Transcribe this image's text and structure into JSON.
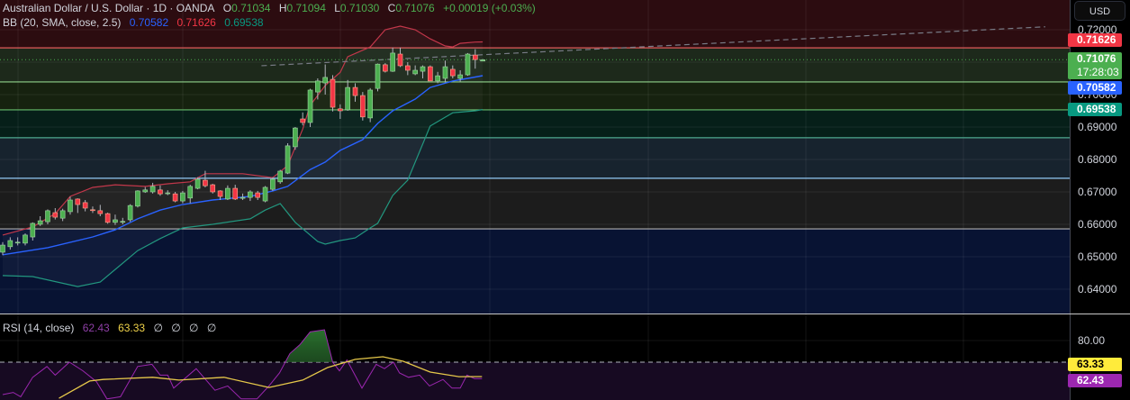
{
  "header": {
    "symbol": "Australian Dollar / U.S. Dollar · 1D · OANDA",
    "o_label": "O",
    "o": "0.71034",
    "h_label": "H",
    "h": "0.71094",
    "l_label": "L",
    "l": "0.71030",
    "c_label": "C",
    "c": "0.71076",
    "change": "+0.00019 (+0.03%)"
  },
  "bb_legend": {
    "label": "BB (20, SMA, close, 2.5)",
    "basis": "0.70582",
    "upper": "0.71626",
    "lower": "0.69538"
  },
  "rsi_legend": {
    "label": "RSI (14, close)",
    "rsi": "62.43",
    "ma": "63.33",
    "empties": [
      "∅",
      "∅",
      "∅",
      "∅"
    ]
  },
  "price_axis": {
    "currency": "USD",
    "ticks": [
      {
        "text": "0.72000",
        "value": 0.72
      },
      {
        "text": "0.70000",
        "value": 0.7
      },
      {
        "text": "0.69000",
        "value": 0.69
      },
      {
        "text": "0.68000",
        "value": 0.68
      },
      {
        "text": "0.67000",
        "value": 0.67
      },
      {
        "text": "0.66000",
        "value": 0.66
      },
      {
        "text": "0.65000",
        "value": 0.65
      },
      {
        "text": "0.64000",
        "value": 0.64
      }
    ],
    "badges": [
      {
        "name": "bb-upper-price-badge",
        "text": "0.71626",
        "value": 0.71626,
        "color": "#f23645",
        "text_color": "#ffffff"
      },
      {
        "name": "last-price-badge",
        "text": "0.71076",
        "sub": "17:28:03",
        "value": 0.71076,
        "color": "#4caf50",
        "text_color": "#ffffff"
      },
      {
        "name": "bb-basis-price-badge",
        "text": "0.70582",
        "value": 0.70582,
        "color": "#2962ff",
        "text_color": "#ffffff"
      },
      {
        "name": "bb-lower-price-badge",
        "text": "0.69538",
        "value": 0.69538,
        "color": "#089981",
        "text_color": "#ffffff"
      }
    ]
  },
  "rsi_axis": {
    "ticks": [
      {
        "text": "80.00",
        "value": 80
      }
    ],
    "badges": [
      {
        "name": "rsi-ma-badge",
        "text": "63.33",
        "value": 63.33,
        "color": "#ffeb3b",
        "text_color": "#000000"
      },
      {
        "name": "rsi-value-badge",
        "text": "62.43",
        "value": 62.43,
        "color": "#9c27b0",
        "text_color": "#ffffff"
      }
    ]
  },
  "colors": {
    "up": "#4caf50",
    "down": "#f23645",
    "wick": "#b2b5be",
    "bb_basis": "#2962ff",
    "bb_upper": "#c2374a",
    "bb_lower": "#22977f",
    "rsi_line": "#9c27b0",
    "rsi_ma": "#e6c84a",
    "trend_line": "#787b86",
    "last_price_line": "#4caf50"
  },
  "levels": [
    {
      "price": 0.7144,
      "line": "#e05a5a",
      "fill_above": "#2c0c10",
      "fill_below": "#1d291b"
    },
    {
      "price": 0.7039,
      "line": "#8fd18a",
      "fill_below": "#16220f"
    },
    {
      "price": 0.6953,
      "line": "#66bb6a",
      "fill_below": "#061f19"
    },
    {
      "price": 0.6867,
      "line": "#4fa88f",
      "fill_below": "#17232e"
    },
    {
      "price": 0.6742,
      "line": "#90caf9",
      "fill_below": "#1c1c1c"
    },
    {
      "price": 0.6586,
      "line": "#b0b0b0",
      "fill_below": "#081333"
    }
  ],
  "trend_line": {
    "style": "dashed",
    "points": [
      [
        34.5,
        0.7089
      ],
      [
        139,
        0.7209
      ]
    ]
  },
  "chart_data": [
    {
      "type": "candlestick",
      "symbol": "AUDUSD",
      "timeframe": "1D",
      "ylim": [
        0.6365,
        0.7292
      ],
      "grid": true,
      "ohlc_fields": [
        "open",
        "high",
        "low",
        "close"
      ],
      "candles": [
        [
          0.6514,
          0.6545,
          0.6505,
          0.6536
        ],
        [
          0.6531,
          0.656,
          0.6522,
          0.655
        ],
        [
          0.6544,
          0.656,
          0.6535,
          0.6545
        ],
        [
          0.6542,
          0.6572,
          0.6535,
          0.6567
        ],
        [
          0.6561,
          0.6606,
          0.655,
          0.6603
        ],
        [
          0.66,
          0.6625,
          0.6595,
          0.6611
        ],
        [
          0.6608,
          0.6646,
          0.66,
          0.6642
        ],
        [
          0.6636,
          0.665,
          0.6615,
          0.6622
        ],
        [
          0.6619,
          0.6648,
          0.661,
          0.6642
        ],
        [
          0.6639,
          0.6685,
          0.663,
          0.6675
        ],
        [
          0.6678,
          0.668,
          0.6635,
          0.6661
        ],
        [
          0.6667,
          0.6675,
          0.664,
          0.665
        ],
        [
          0.6645,
          0.6655,
          0.6635,
          0.6644
        ],
        [
          0.6642,
          0.666,
          0.6625,
          0.6633
        ],
        [
          0.6633,
          0.6636,
          0.6602,
          0.6606
        ],
        [
          0.6606,
          0.663,
          0.6598,
          0.6614
        ],
        [
          0.6608,
          0.662,
          0.66,
          0.6609
        ],
        [
          0.6614,
          0.6662,
          0.6608,
          0.6658
        ],
        [
          0.6656,
          0.6705,
          0.6652,
          0.6703
        ],
        [
          0.67,
          0.6715,
          0.6697,
          0.6706
        ],
        [
          0.67,
          0.6728,
          0.6695,
          0.6717
        ],
        [
          0.6706,
          0.672,
          0.6688,
          0.6694
        ],
        [
          0.6697,
          0.6705,
          0.669,
          0.6697
        ],
        [
          0.6694,
          0.67,
          0.6668,
          0.6672
        ],
        [
          0.6672,
          0.6703,
          0.6665,
          0.6697
        ],
        [
          0.6681,
          0.6722,
          0.6665,
          0.6717
        ],
        [
          0.6711,
          0.6745,
          0.6708,
          0.6739
        ],
        [
          0.6736,
          0.6765,
          0.6714,
          0.6719
        ],
        [
          0.6722,
          0.6725,
          0.6695,
          0.67
        ],
        [
          0.6703,
          0.6705,
          0.6675,
          0.6686
        ],
        [
          0.6678,
          0.672,
          0.6675,
          0.6711
        ],
        [
          0.6711,
          0.6722,
          0.6675,
          0.6678
        ],
        [
          0.6683,
          0.6695,
          0.6675,
          0.6683
        ],
        [
          0.6683,
          0.6705,
          0.6672,
          0.67
        ],
        [
          0.6697,
          0.6703,
          0.6675,
          0.6683
        ],
        [
          0.6672,
          0.6718,
          0.6668,
          0.6714
        ],
        [
          0.6708,
          0.6745,
          0.6703,
          0.6739
        ],
        [
          0.6731,
          0.6768,
          0.6725,
          0.6764
        ],
        [
          0.6758,
          0.685,
          0.6755,
          0.6842
        ],
        [
          0.6839,
          0.69,
          0.683,
          0.6897
        ],
        [
          0.6925,
          0.6945,
          0.6905,
          0.6914
        ],
        [
          0.6914,
          0.7018,
          0.69,
          0.7014
        ],
        [
          0.7008,
          0.705,
          0.6985,
          0.7042
        ],
        [
          0.7036,
          0.7093,
          0.7,
          0.7053
        ],
        [
          0.7047,
          0.706,
          0.6948,
          0.6961
        ],
        [
          0.6956,
          0.697,
          0.6925,
          0.695
        ],
        [
          0.6953,
          0.7045,
          0.695,
          0.7022
        ],
        [
          0.7022,
          0.7035,
          0.6978,
          0.6997
        ],
        [
          0.6997,
          0.7008,
          0.692,
          0.6931
        ],
        [
          0.6928,
          0.702,
          0.6915,
          0.7014
        ],
        [
          0.7019,
          0.7096,
          0.701,
          0.7094
        ],
        [
          0.7092,
          0.7097,
          0.7068,
          0.7072
        ],
        [
          0.7072,
          0.7145,
          0.707,
          0.7128
        ],
        [
          0.7125,
          0.7145,
          0.7085,
          0.7089
        ],
        [
          0.7089,
          0.71,
          0.706,
          0.7075
        ],
        [
          0.7064,
          0.709,
          0.706,
          0.7075
        ],
        [
          0.7072,
          0.709,
          0.705,
          0.7086
        ],
        [
          0.7086,
          0.709,
          0.7042,
          0.7042
        ],
        [
          0.7042,
          0.707,
          0.7035,
          0.7058
        ],
        [
          0.705,
          0.7105,
          0.7038,
          0.7086
        ],
        [
          0.7078,
          0.709,
          0.705,
          0.7058
        ],
        [
          0.705,
          0.7075,
          0.704,
          0.7061
        ],
        [
          0.7061,
          0.7128,
          0.7058,
          0.7125
        ],
        [
          0.7122,
          0.714,
          0.708,
          0.7108
        ],
        [
          0.71034,
          0.71094,
          0.7103,
          0.71076
        ]
      ],
      "bollinger_bands": {
        "params": "BB (20, SMA, close, 2.5)",
        "upper": [
          [
            0,
            0.6567
          ],
          [
            4,
            0.6592
          ],
          [
            7,
            0.6633
          ],
          [
            9,
            0.6686
          ],
          [
            12,
            0.6714
          ],
          [
            15,
            0.6722
          ],
          [
            19,
            0.6717
          ],
          [
            22,
            0.6725
          ],
          [
            25,
            0.6731
          ],
          [
            27,
            0.6756
          ],
          [
            32,
            0.6756
          ],
          [
            36,
            0.6744
          ],
          [
            38,
            0.6781
          ],
          [
            40,
            0.6894
          ],
          [
            41,
            0.6967
          ],
          [
            43,
            0.7028
          ],
          [
            45,
            0.7069
          ],
          [
            46,
            0.7117
          ],
          [
            49,
            0.7147
          ],
          [
            51,
            0.72
          ],
          [
            53,
            0.7211
          ],
          [
            55,
            0.72
          ],
          [
            57,
            0.7172
          ],
          [
            59,
            0.715
          ],
          [
            60,
            0.7147
          ],
          [
            61,
            0.7158
          ],
          [
            63,
            0.7162
          ],
          [
            64,
            0.71626
          ]
        ],
        "basis": [
          [
            0,
            0.6506
          ],
          [
            6,
            0.6528
          ],
          [
            12,
            0.6561
          ],
          [
            15,
            0.6583
          ],
          [
            18,
            0.6617
          ],
          [
            21,
            0.6644
          ],
          [
            24,
            0.6661
          ],
          [
            28,
            0.6675
          ],
          [
            33,
            0.6686
          ],
          [
            36,
            0.6703
          ],
          [
            38,
            0.6717
          ],
          [
            41,
            0.6769
          ],
          [
            43,
            0.6792
          ],
          [
            45,
            0.6828
          ],
          [
            48,
            0.6861
          ],
          [
            50,
            0.6911
          ],
          [
            52,
            0.695
          ],
          [
            55,
            0.6986
          ],
          [
            57,
            0.7022
          ],
          [
            60,
            0.7042
          ],
          [
            62,
            0.705
          ],
          [
            64,
            0.70582
          ]
        ],
        "lower": [
          [
            0,
            0.6442
          ],
          [
            4,
            0.6439
          ],
          [
            10,
            0.6408
          ],
          [
            13,
            0.6422
          ],
          [
            18,
            0.6519
          ],
          [
            21,
            0.6556
          ],
          [
            24,
            0.6589
          ],
          [
            28,
            0.66
          ],
          [
            33,
            0.6617
          ],
          [
            35,
            0.6644
          ],
          [
            37,
            0.6664
          ],
          [
            39,
            0.6606
          ],
          [
            42,
            0.6547
          ],
          [
            43,
            0.6539
          ],
          [
            45,
            0.655
          ],
          [
            47,
            0.6558
          ],
          [
            49,
            0.6589
          ],
          [
            50,
            0.6603
          ],
          [
            52,
            0.6689
          ],
          [
            54,
            0.6736
          ],
          [
            57,
            0.6903
          ],
          [
            60,
            0.6944
          ],
          [
            63,
            0.695
          ],
          [
            64,
            0.69538
          ]
        ]
      }
    },
    {
      "type": "line",
      "ylim": [
        52,
        92
      ],
      "ticks": [
        80
      ],
      "reference_line": 70,
      "series": [
        {
          "name": "RSI (14, close)",
          "points": [
            [
              0,
              55
            ],
            [
              1.4,
              56
            ],
            [
              2.4,
              54
            ],
            [
              4,
              63
            ],
            [
              5.9,
              68
            ],
            [
              7,
              64
            ],
            [
              8.9,
              70
            ],
            [
              10.7,
              66
            ],
            [
              12.5,
              61
            ],
            [
              13.9,
              53
            ],
            [
              15.7,
              54
            ],
            [
              18,
              68
            ],
            [
              19.9,
              69
            ],
            [
              21,
              64
            ],
            [
              22,
              64
            ],
            [
              22.8,
              58
            ],
            [
              25.8,
              67
            ],
            [
              28.3,
              57
            ],
            [
              30,
              59
            ],
            [
              31.8,
              53
            ],
            [
              33.9,
              53
            ],
            [
              35.5,
              59
            ],
            [
              36.9,
              65
            ],
            [
              38.3,
              74
            ],
            [
              39.6,
              78
            ],
            [
              41,
              84
            ],
            [
              42.9,
              85
            ],
            [
              44,
              70
            ],
            [
              44.9,
              66
            ],
            [
              45.9,
              71
            ],
            [
              47.9,
              58
            ],
            [
              49.8,
              69
            ],
            [
              50.9,
              67
            ],
            [
              52.1,
              70
            ],
            [
              52.9,
              65
            ],
            [
              54.1,
              63
            ],
            [
              55.6,
              64
            ],
            [
              56.9,
              59
            ],
            [
              58.7,
              62
            ],
            [
              59.9,
              58
            ],
            [
              61,
              58
            ],
            [
              61.9,
              64
            ],
            [
              62.9,
              62.4
            ],
            [
              63.9,
              62.43
            ]
          ]
        },
        {
          "name": "RSI-based MA",
          "points": [
            [
              7.5,
              53.3
            ],
            [
              11.6,
              61.3
            ],
            [
              13.4,
              62
            ],
            [
              20,
              63
            ],
            [
              23.5,
              61.7
            ],
            [
              29.5,
              63
            ],
            [
              35.5,
              58.3
            ],
            [
              40,
              61.7
            ],
            [
              43.3,
              67.5
            ],
            [
              47,
              71.3
            ],
            [
              50.7,
              72.5
            ],
            [
              53.4,
              70.4
            ],
            [
              57,
              65.4
            ],
            [
              60.8,
              63.3
            ],
            [
              63.9,
              63.33
            ]
          ]
        }
      ]
    }
  ]
}
